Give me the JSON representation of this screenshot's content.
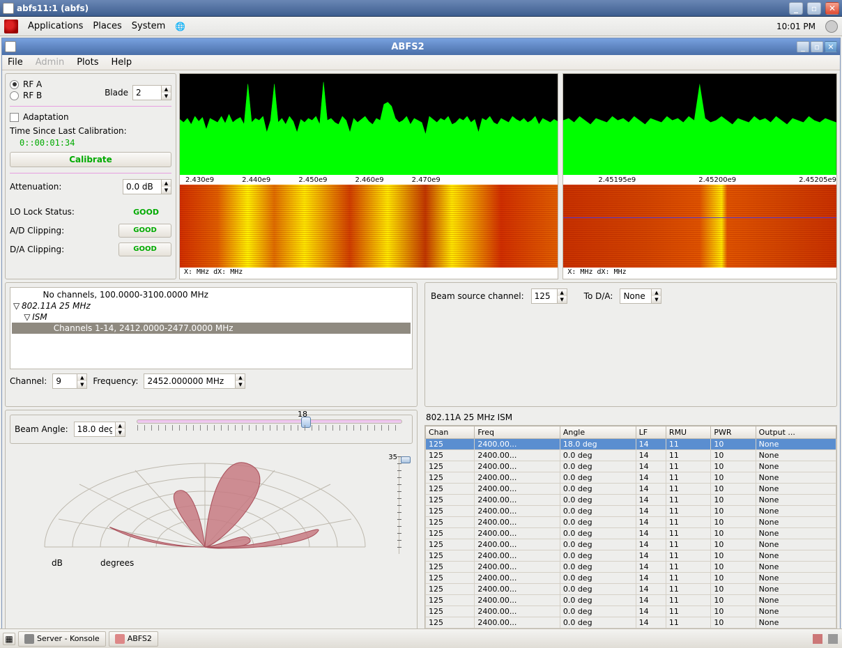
{
  "outer_window": {
    "title": "abfs11:1 (abfs)"
  },
  "gnome": {
    "menus": [
      "Applications",
      "Places",
      "System"
    ],
    "clock": "10:01 PM"
  },
  "app_window": {
    "title": "ABFS2",
    "menubar": [
      "File",
      "Admin",
      "Plots",
      "Help"
    ],
    "menubar_disabled_index": 1
  },
  "ctrl": {
    "rf_a": "RF A",
    "rf_b": "RF B",
    "blade_label": "Blade",
    "blade_value": "2",
    "adaptation": "Adaptation",
    "time_since_label": "Time Since Last Calibration:",
    "time_since_value": "0::00:01:34",
    "calibrate": "Calibrate",
    "attenuation_label": "Attenuation:",
    "attenuation_value": "0.0 dB",
    "lo_lock": "LO Lock Status:",
    "lo_lock_val": "GOOD",
    "ad_clip": "A/D Clipping:",
    "ad_clip_val": "GOOD",
    "da_clip": "D/A Clipping:",
    "da_clip_val": "GOOD"
  },
  "spectrum_left": {
    "ticks": [
      "2.430e9",
      "2.440e9",
      "2.450e9",
      "2.460e9",
      "2.470e9"
    ],
    "xinfo": "X:           MHz   dX:           MHz"
  },
  "spectrum_right": {
    "ticks": [
      "2.45195e9",
      "2.45200e9",
      "2.45205e9"
    ],
    "xinfo": "X:           MHz   dX:           MHz"
  },
  "tree": {
    "lines": [
      {
        "indent": 2,
        "toggle": "",
        "text": "No channels, 100.0000-3100.0000 MHz",
        "sel": false,
        "italic": false
      },
      {
        "indent": 0,
        "toggle": "▽",
        "text": "802.11A 25 MHz",
        "sel": false,
        "italic": true
      },
      {
        "indent": 1,
        "toggle": "▽",
        "text": "ISM",
        "sel": false,
        "italic": true
      },
      {
        "indent": 3,
        "toggle": "",
        "text": "Channels 1-14, 2412.0000-2477.0000 MHz",
        "sel": true,
        "italic": false
      }
    ],
    "channel_label": "Channel:",
    "channel_value": "9",
    "freq_label": "Frequency:",
    "freq_value": "2452.000000 MHz"
  },
  "beam_source": {
    "label": "Beam source channel:",
    "value": "125",
    "to_da_label": "To D/A:",
    "to_da_value": "None"
  },
  "beam": {
    "label": "Beam Angle:",
    "value": "18.0 deg",
    "slider_value": "18",
    "polar_axis_db": "dB",
    "polar_axis_deg": "degrees",
    "vslider_label": "35"
  },
  "table": {
    "title": "802.11A 25 MHz ISM",
    "headers": [
      "Chan",
      "Freq",
      "Angle",
      "LF",
      "RMU",
      "PWR",
      "Output ..."
    ],
    "first_row": {
      "Chan": "125",
      "Freq": "2400.00...",
      "Angle": "18.0 deg",
      "LF": "14",
      "RMU": "11",
      "PWR": "10",
      "Output": "None"
    },
    "rows": [
      {
        "Chan": "125",
        "Freq": "2400.00...",
        "Angle": "0.0 deg",
        "LF": "14",
        "RMU": "11",
        "PWR": "10",
        "Output": "None"
      },
      {
        "Chan": "125",
        "Freq": "2400.00...",
        "Angle": "0.0 deg",
        "LF": "14",
        "RMU": "11",
        "PWR": "10",
        "Output": "None"
      },
      {
        "Chan": "125",
        "Freq": "2400.00...",
        "Angle": "0.0 deg",
        "LF": "14",
        "RMU": "11",
        "PWR": "10",
        "Output": "None"
      },
      {
        "Chan": "125",
        "Freq": "2400.00...",
        "Angle": "0.0 deg",
        "LF": "14",
        "RMU": "11",
        "PWR": "10",
        "Output": "None"
      },
      {
        "Chan": "125",
        "Freq": "2400.00...",
        "Angle": "0.0 deg",
        "LF": "14",
        "RMU": "11",
        "PWR": "10",
        "Output": "None"
      },
      {
        "Chan": "125",
        "Freq": "2400.00...",
        "Angle": "0.0 deg",
        "LF": "14",
        "RMU": "11",
        "PWR": "10",
        "Output": "None"
      },
      {
        "Chan": "125",
        "Freq": "2400.00...",
        "Angle": "0.0 deg",
        "LF": "14",
        "RMU": "11",
        "PWR": "10",
        "Output": "None"
      },
      {
        "Chan": "125",
        "Freq": "2400.00...",
        "Angle": "0.0 deg",
        "LF": "14",
        "RMU": "11",
        "PWR": "10",
        "Output": "None"
      },
      {
        "Chan": "125",
        "Freq": "2400.00...",
        "Angle": "0.0 deg",
        "LF": "14",
        "RMU": "11",
        "PWR": "10",
        "Output": "None"
      },
      {
        "Chan": "125",
        "Freq": "2400.00...",
        "Angle": "0.0 deg",
        "LF": "14",
        "RMU": "11",
        "PWR": "10",
        "Output": "None"
      },
      {
        "Chan": "125",
        "Freq": "2400.00...",
        "Angle": "0.0 deg",
        "LF": "14",
        "RMU": "11",
        "PWR": "10",
        "Output": "None"
      },
      {
        "Chan": "125",
        "Freq": "2400.00...",
        "Angle": "0.0 deg",
        "LF": "14",
        "RMU": "11",
        "PWR": "10",
        "Output": "None"
      },
      {
        "Chan": "125",
        "Freq": "2400.00...",
        "Angle": "0.0 deg",
        "LF": "14",
        "RMU": "11",
        "PWR": "10",
        "Output": "None"
      },
      {
        "Chan": "125",
        "Freq": "2400.00...",
        "Angle": "0.0 deg",
        "LF": "14",
        "RMU": "11",
        "PWR": "10",
        "Output": "None"
      },
      {
        "Chan": "125",
        "Freq": "2400.00...",
        "Angle": "0.0 deg",
        "LF": "14",
        "RMU": "11",
        "PWR": "10",
        "Output": "None"
      },
      {
        "Chan": "125",
        "Freq": "2400.00...",
        "Angle": "0.0 deg",
        "LF": "14",
        "RMU": "11",
        "PWR": "10",
        "Output": "None"
      }
    ]
  },
  "taskbar": {
    "items": [
      "Server - Konsole",
      "ABFS2"
    ]
  }
}
